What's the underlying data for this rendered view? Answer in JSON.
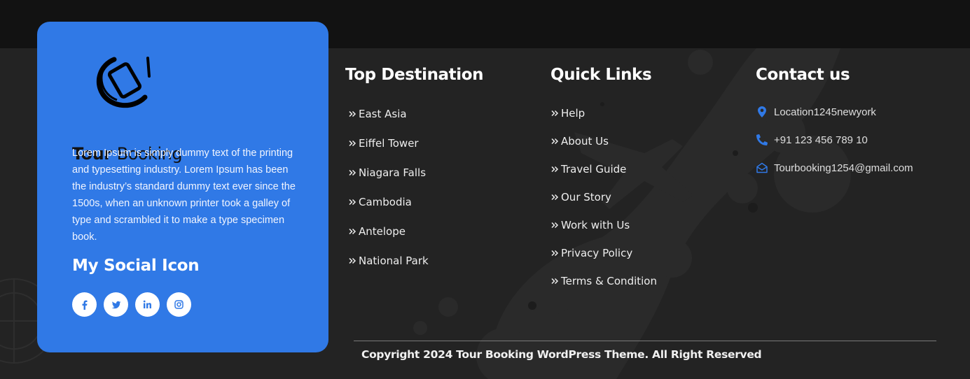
{
  "brand": {
    "logo_bold": "Tour",
    "logo_light": " Booking",
    "about": "Lorem Ipsum is simply dummy text of the printing and typesetting industry. Lorem Ipsum has been the industry’s standard dummy text ever since the 1500s, when an unknown printer took a galley of type and scrambled it to make a type specimen book.",
    "social_title": "My Social Icon",
    "socials": [
      {
        "icon": "facebook-icon"
      },
      {
        "icon": "twitter-icon"
      },
      {
        "icon": "linkedin-icon"
      },
      {
        "icon": "instagram-icon"
      }
    ]
  },
  "top_destination": {
    "title": "Top Destination",
    "items": [
      "East Asia",
      "Eiffel Tower",
      "Niagara Falls",
      "Cambodia",
      "Antelope",
      "National Park"
    ]
  },
  "quick_links": {
    "title": "Quick Links",
    "items": [
      "Help",
      "About Us",
      "Travel Guide",
      "Our Story",
      "Work with Us",
      "Privacy Policy",
      "Terms & Condition"
    ]
  },
  "contact": {
    "title": "Contact us",
    "items": [
      {
        "icon": "location-pin-icon",
        "text": "Location1245newyork"
      },
      {
        "icon": "phone-icon",
        "text": "+91 123 456 789 10"
      },
      {
        "icon": "envelope-open-icon",
        "text": "Tourbooking1254@gmail.com"
      }
    ]
  },
  "footer": {
    "copyright": "Copyright 2024 Tour Booking WordPress Theme. All Right Reserved"
  },
  "colors": {
    "accent": "#3079e6",
    "footer_bg": "#232323",
    "top_strip": "#121212"
  }
}
